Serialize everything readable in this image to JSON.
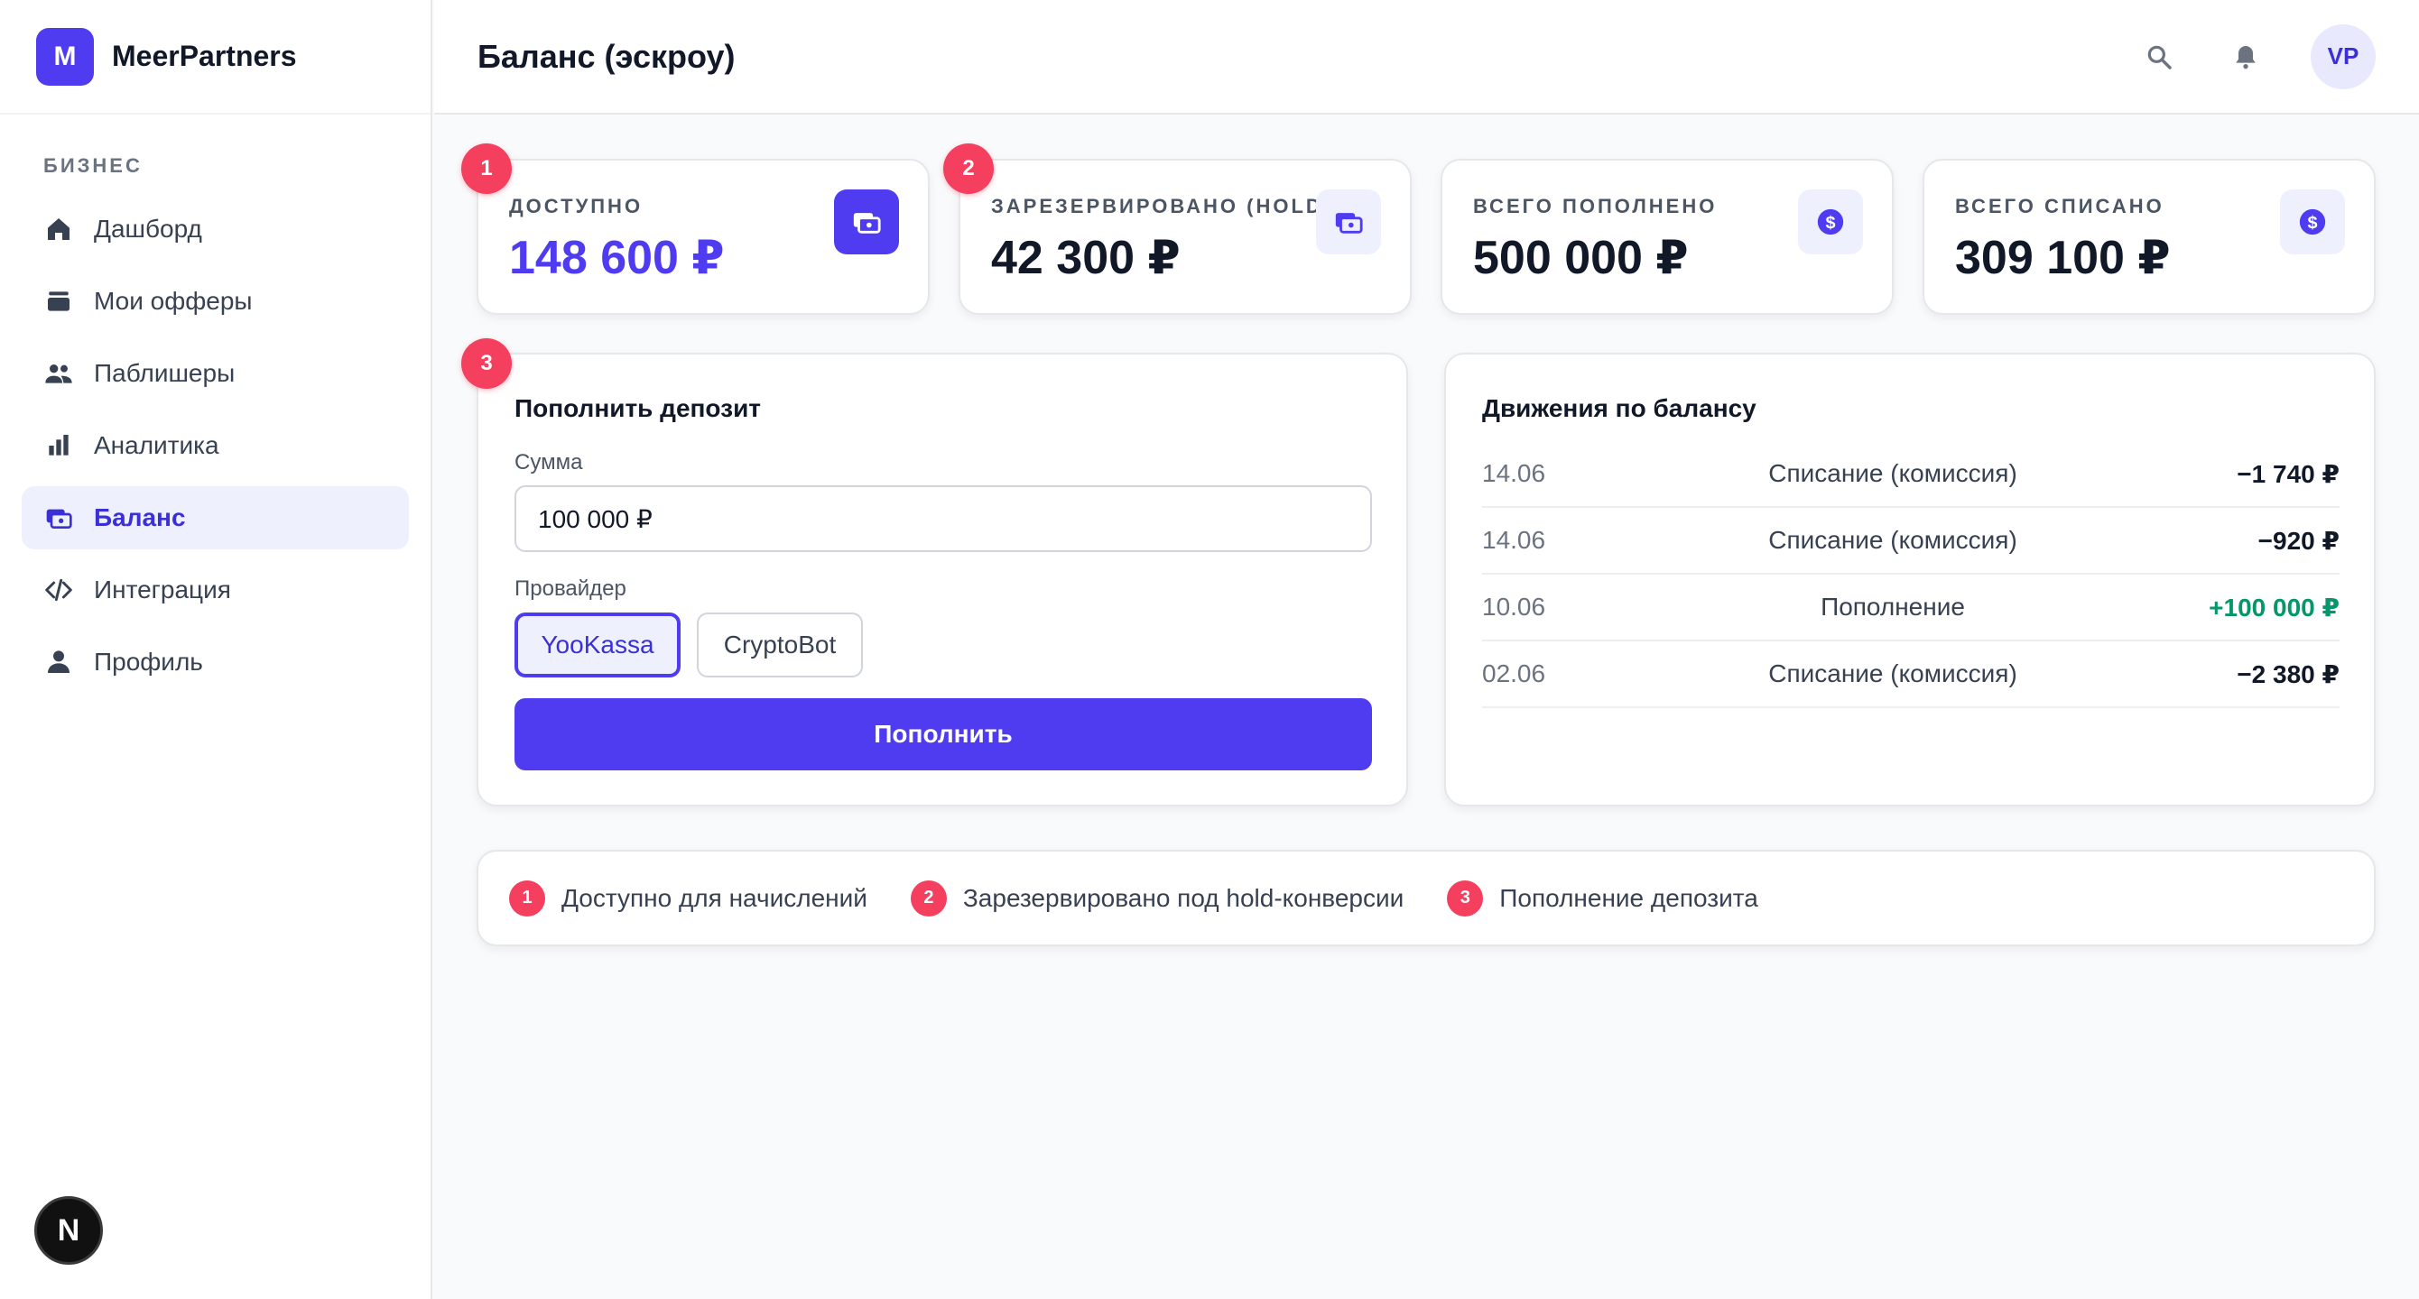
{
  "brand": {
    "logo_letter": "M",
    "name": "MeerPartners"
  },
  "sidebar": {
    "section_label": "БИЗНЕС",
    "items": [
      {
        "label": "Дашборд",
        "icon": "home-icon"
      },
      {
        "label": "Мои офферы",
        "icon": "stack-icon"
      },
      {
        "label": "Паблишеры",
        "icon": "users-icon"
      },
      {
        "label": "Аналитика",
        "icon": "bar-chart-icon"
      },
      {
        "label": "Баланс",
        "icon": "wallet-icon",
        "active": true
      },
      {
        "label": "Интеграция",
        "icon": "code-icon"
      },
      {
        "label": "Профиль",
        "icon": "person-icon"
      }
    ],
    "footer_badge": "N"
  },
  "header": {
    "title": "Баланс (эскроу)",
    "avatar_initials": "VP"
  },
  "stats": [
    {
      "marker": "1",
      "label": "Доступно",
      "value": "148 600 ₽",
      "icon": "wallet-icon"
    },
    {
      "marker": "2",
      "label": "Зарезервировано (hold)",
      "value": "42 300 ₽",
      "icon": "wallet-icon"
    },
    {
      "label": "Всего пополнено",
      "value": "500 000 ₽",
      "icon": "dollar-icon"
    },
    {
      "label": "Всего списано",
      "value": "309 100 ₽",
      "icon": "dollar-icon"
    }
  ],
  "deposit": {
    "marker": "3",
    "title": "Пополнить депозит",
    "amount_label": "Сумма",
    "amount_value": "100 000 ₽",
    "provider_label": "Провайдер",
    "providers": [
      "YooKassa",
      "CryptoBot"
    ],
    "selected_provider": "YooKassa",
    "submit_label": "Пополнить"
  },
  "movements": {
    "title": "Движения по балансу",
    "rows": [
      {
        "date": "14.06",
        "description": "Списание (комиссия)",
        "amount": "−1 740 ₽"
      },
      {
        "date": "14.06",
        "description": "Списание (комиссия)",
        "amount": "−920 ₽"
      },
      {
        "date": "10.06",
        "description": "Пополнение",
        "amount": "+100 000 ₽"
      },
      {
        "date": "02.06",
        "description": "Списание (комиссия)",
        "amount": "−2 380 ₽"
      }
    ]
  },
  "legend": [
    {
      "marker": "1",
      "text": "Доступно для начислений"
    },
    {
      "marker": "2",
      "text": "Зарезервировано под hold-конверсии"
    },
    {
      "marker": "3",
      "text": "Пополнение депозита"
    }
  ],
  "colors": {
    "accent": "#4f3cf0",
    "marker": "#f43f5e",
    "positive": "#059669",
    "active_bg": "#eef0fd"
  }
}
